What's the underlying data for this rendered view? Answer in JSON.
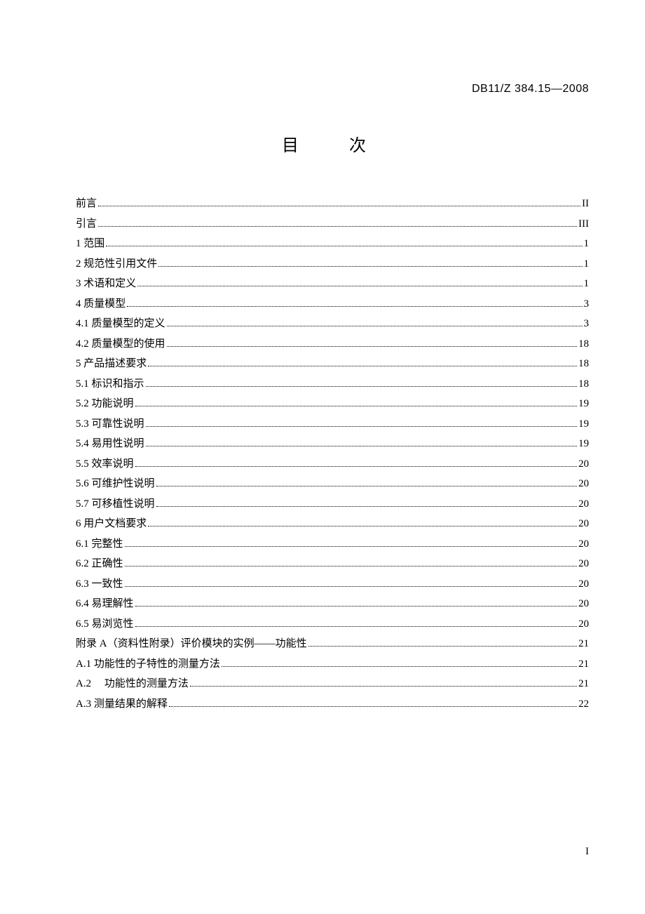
{
  "header": {
    "document_code": "DB11/Z 384.15—2008"
  },
  "title": "目　次",
  "toc": [
    {
      "label": "前言",
      "page": "II"
    },
    {
      "label": "引言",
      "page": "III"
    },
    {
      "label": "1  范围",
      "page": "1"
    },
    {
      "label": "2  规范性引用文件",
      "page": "1"
    },
    {
      "label": "3  术语和定义",
      "page": "1"
    },
    {
      "label": "4  质量模型",
      "page": "3"
    },
    {
      "label": "4.1  质量模型的定义",
      "page": "3"
    },
    {
      "label": "4.2  质量模型的使用",
      "page": "18"
    },
    {
      "label": "5  产品描述要求",
      "page": "18"
    },
    {
      "label": "5.1  标识和指示",
      "page": "18"
    },
    {
      "label": "5.2  功能说明",
      "page": "19"
    },
    {
      "label": "5.3  可靠性说明",
      "page": "19"
    },
    {
      "label": "5.4  易用性说明",
      "page": "19"
    },
    {
      "label": "5.5  效率说明",
      "page": "20"
    },
    {
      "label": "5.6  可维护性说明",
      "page": "20"
    },
    {
      "label": "5.7  可移植性说明",
      "page": "20"
    },
    {
      "label": "6  用户文档要求",
      "page": "20"
    },
    {
      "label": "6.1  完整性",
      "page": "20"
    },
    {
      "label": "6.2  正确性",
      "page": "20"
    },
    {
      "label": "6.3  一致性",
      "page": "20"
    },
    {
      "label": "6.4  易理解性",
      "page": "20"
    },
    {
      "label": "6.5  易浏览性",
      "page": "20"
    },
    {
      "label": "附录 A（资料性附录）评价模块的实例——功能性",
      "page": "21"
    },
    {
      "label": "A.1  功能性的子特性的测量方法",
      "page": "21"
    },
    {
      "label": "A.2 　功能性的测量方法",
      "page": "21"
    },
    {
      "label": "A.3  测量结果的解释",
      "page": "22"
    }
  ],
  "footer": {
    "page_number": "I"
  }
}
